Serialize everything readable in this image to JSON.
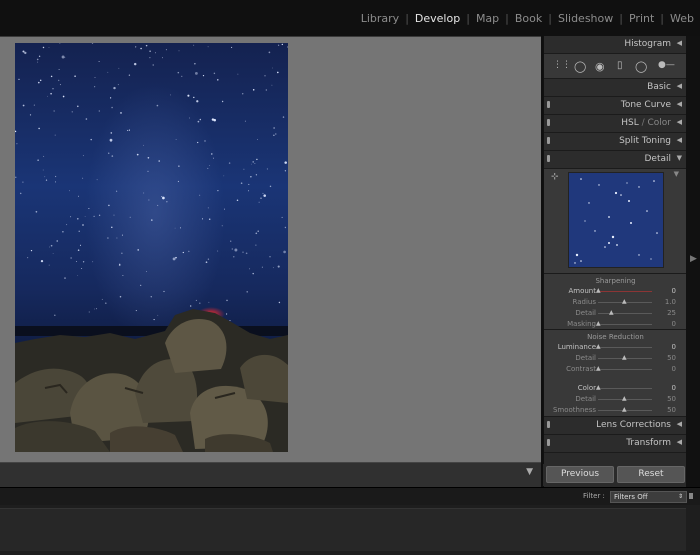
{
  "modules": [
    {
      "label": "Library",
      "active": false
    },
    {
      "label": "Develop",
      "active": true
    },
    {
      "label": "Map",
      "active": false
    },
    {
      "label": "Book",
      "active": false
    },
    {
      "label": "Slideshow",
      "active": false
    },
    {
      "label": "Print",
      "active": false
    },
    {
      "label": "Web",
      "active": false
    }
  ],
  "panels": {
    "histogram": "Histogram",
    "basic": "Basic",
    "tone_curve": "Tone Curve",
    "hsl": "HSL",
    "hsl_sep": " / ",
    "color": "Color",
    "split_toning": "Split Toning",
    "detail": "Detail",
    "lens_corrections": "Lens Corrections",
    "transform": "Transform"
  },
  "sharpening": {
    "title": "Sharpening",
    "sliders": [
      {
        "label": "Amount",
        "value": "0",
        "level": 0
      },
      {
        "label": "Radius",
        "value": "1.0",
        "level": 0.5
      },
      {
        "label": "Detail",
        "value": "25",
        "level": 0.25
      },
      {
        "label": "Masking",
        "value": "0",
        "level": 0
      }
    ]
  },
  "noise_reduction": {
    "title": "Noise Reduction",
    "luminance": [
      {
        "label": "Luminance",
        "value": "0",
        "level": 0
      },
      {
        "label": "Detail",
        "value": "50",
        "level": 0.5
      },
      {
        "label": "Contrast",
        "value": "0",
        "level": 0
      }
    ],
    "color": [
      {
        "label": "Color",
        "value": "0",
        "level": 0
      },
      {
        "label": "Detail",
        "value": "50",
        "level": 0.5
      },
      {
        "label": "Smoothness",
        "value": "50",
        "level": 0.5
      }
    ]
  },
  "buttons": {
    "previous": "Previous",
    "reset": "Reset"
  },
  "filter": {
    "label": "Filter :",
    "value": "Filters Off"
  },
  "colors": {
    "accent_red": "#8c3535",
    "canvas_bg": "#757575",
    "panel_bg": "#2a2a2a"
  }
}
